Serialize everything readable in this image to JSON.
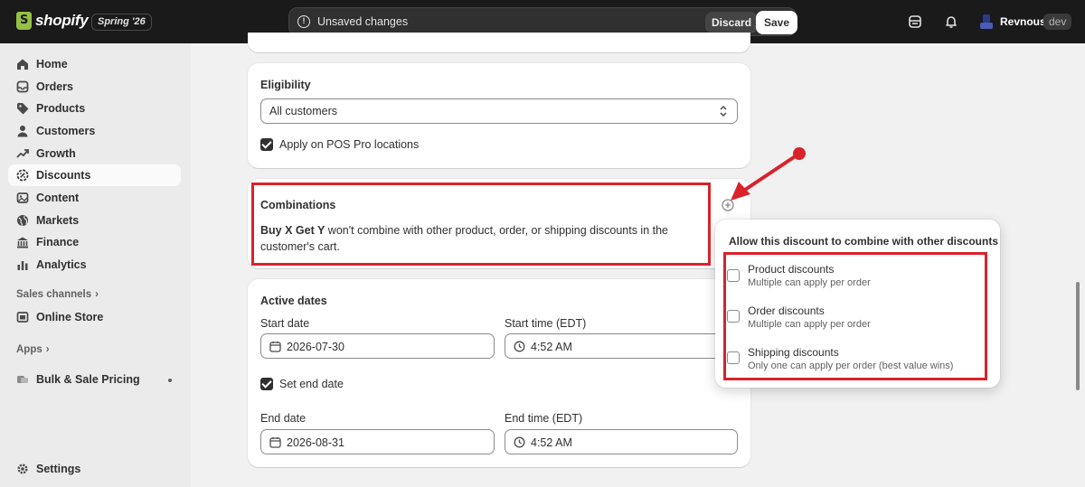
{
  "topbar": {
    "logo_text": "shopify",
    "edition": "Spring '26",
    "unsaved_message": "Unsaved changes",
    "discard_label": "Discard",
    "save_label": "Save",
    "user_name": "Revnous",
    "user_tag": "dev"
  },
  "sidebar": {
    "items": [
      {
        "label": "Home",
        "icon": "home-icon"
      },
      {
        "label": "Orders",
        "icon": "inbox-icon"
      },
      {
        "label": "Products",
        "icon": "tag-icon"
      },
      {
        "label": "Customers",
        "icon": "person-icon"
      },
      {
        "label": "Growth",
        "icon": "growth-icon"
      },
      {
        "label": "Discounts",
        "icon": "discount-icon",
        "active": true
      },
      {
        "label": "Content",
        "icon": "content-icon"
      },
      {
        "label": "Markets",
        "icon": "globe-icon"
      },
      {
        "label": "Finance",
        "icon": "bank-icon"
      },
      {
        "label": "Analytics",
        "icon": "chart-icon"
      }
    ],
    "sales_channels_label": "Sales channels",
    "online_store_label": "Online Store",
    "apps_label": "Apps",
    "app_item_label": "Bulk & Sale Pricing",
    "settings_label": "Settings"
  },
  "eligibility": {
    "title": "Eligibility",
    "selected": "All customers",
    "pos_label": "Apply on POS Pro locations"
  },
  "combinations": {
    "title": "Combinations",
    "bold_text": "Buy X Get Y",
    "text_line1": " won't combine with other product, order, or shipping discounts in the",
    "text_line2": "customer's cart."
  },
  "active_dates": {
    "title": "Active dates",
    "start_date_label": "Start date",
    "start_date": "2026-07-30",
    "start_time_label": "Start time (EDT)",
    "start_time": "4:52 AM",
    "set_end_label": "Set end date",
    "end_date_label": "End date",
    "end_date": "2026-08-31",
    "end_time_label": "End time (EDT)",
    "end_time": "4:52 AM"
  },
  "popover": {
    "title": "Allow this discount to combine with other discounts",
    "options": [
      {
        "title": "Product discounts",
        "subtitle": "Multiple can apply per order",
        "checked": false
      },
      {
        "title": "Order discounts",
        "subtitle": "Multiple can apply per order",
        "checked": false
      },
      {
        "title": "Shipping discounts",
        "subtitle": "Only one can apply per order (best value wins)",
        "checked": false
      }
    ]
  },
  "colors": {
    "annotation_red": "#d8232a",
    "topbar": "#1a1a1a",
    "brand_green": "#95bf47"
  }
}
